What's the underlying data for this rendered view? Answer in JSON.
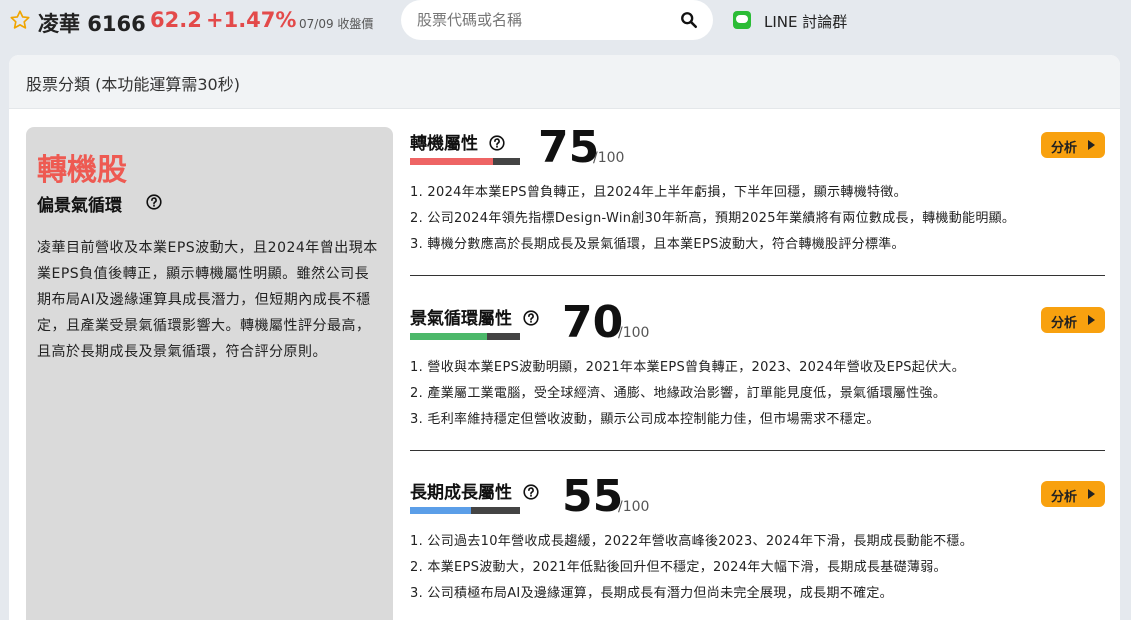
{
  "header": {
    "stock_name": "凌華 6166",
    "price": "62.2",
    "change": "+1.47%",
    "date_label": "07/09 收盤價",
    "search_placeholder": "股票代碼或名稱",
    "line_label": "LINE 討論群",
    "colors": {
      "up": "#e34a4a",
      "line_brand": "#2bbc36"
    }
  },
  "panel": {
    "title": "股票分類 (本功能運算需30秒)"
  },
  "summary": {
    "type": "轉機股",
    "subtitle": "偏景氣循環",
    "text": "凌華目前營收及本業EPS波動大，且2024年曾出現本業EPS負值後轉正，顯示轉機屬性明顯。雖然公司長期布局AI及邊緣運算具成長潛力，但短期內成長不穩定，且產業受景氣循環影響大。轉機屬性評分最高，且高於長期成長及景氣循環，符合評分原則。"
  },
  "sections": [
    {
      "title": "轉機屬性",
      "score": "75",
      "max": "/100",
      "fraction": 0.75,
      "bar_color": "#ee6464",
      "button": "分析",
      "items": [
        "1. 2024年本業EPS曾負轉正，且2024年上半年虧損，下半年回穩，顯示轉機特徵。",
        "2. 公司2024年領先指標Design-Win創30年新高，預期2025年業績將有兩位數成長，轉機動能明顯。",
        "3. 轉機分數應高於長期成長及景氣循環，且本業EPS波動大，符合轉機股評分標準。"
      ]
    },
    {
      "title": "景氣循環屬性",
      "score": "70",
      "max": "/100",
      "fraction": 0.7,
      "bar_color": "#4cb86a",
      "button": "分析",
      "items": [
        "1. 營收與本業EPS波動明顯，2021年本業EPS曾負轉正，2023、2024年營收及EPS起伏大。",
        "2. 產業屬工業電腦，受全球經濟、通膨、地緣政治影響，訂單能見度低，景氣循環屬性強。",
        "3. 毛利率維持穩定但營收波動，顯示公司成本控制能力佳，但市場需求不穩定。"
      ]
    },
    {
      "title": "長期成長屬性",
      "score": "55",
      "max": "/100",
      "fraction": 0.55,
      "bar_color": "#5b9ee8",
      "button": "分析",
      "items": [
        "1. 公司過去10年營收成長趨緩，2022年營收高峰後2023、2024年下滑，長期成長動能不穩。",
        "2. 本業EPS波動大，2021年低點後回升但不穩定，2024年大幅下滑，長期成長基礎薄弱。",
        "3. 公司積極布局AI及邊緣運算，長期成長有潛力但尚未完全展現，成長期不確定。"
      ]
    }
  ]
}
